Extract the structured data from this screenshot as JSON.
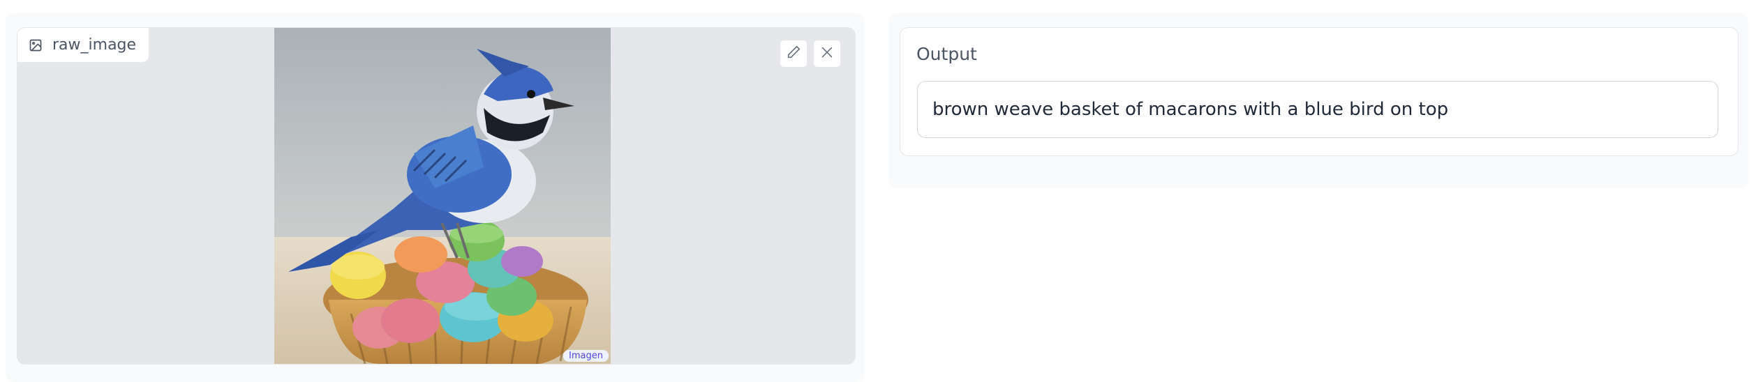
{
  "image_input": {
    "label": "raw_image",
    "badge": "Imagen",
    "icon": "image-icon",
    "edit_icon": "pencil-icon",
    "close_icon": "close-icon"
  },
  "output": {
    "label": "Output",
    "value": "brown weave basket of macarons with a blue bird on top"
  }
}
